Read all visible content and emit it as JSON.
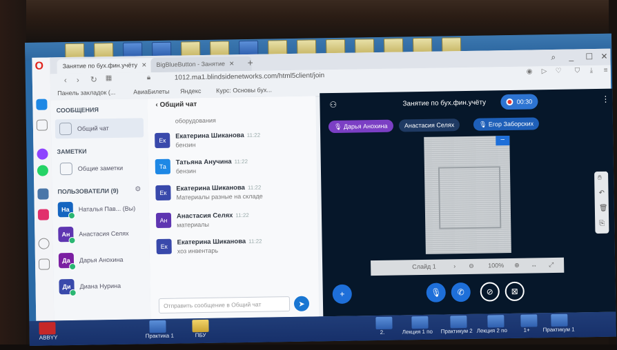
{
  "browser": {
    "tabs": [
      {
        "label": "Занятие по бух.фин.учёту"
      },
      {
        "label": "BigBlueButton - Занятие"
      }
    ],
    "url": "1012.ma1.blindsidenetworks.com/html5client/join",
    "bookmarks": [
      {
        "label": "Панель закладок (..."
      },
      {
        "label": "AвиаБилеты"
      },
      {
        "label": "Яндекс"
      },
      {
        "label": "Курс: Основы бух..."
      }
    ]
  },
  "sidebar": {
    "messages_header": "СООБЩЕНИЯ",
    "public_chat": "Общий чат",
    "notes_header": "ЗАМЕТКИ",
    "shared_notes": "Общие заметки",
    "users_header": "ПОЛЬЗОВАТЕЛИ (9)",
    "users": [
      {
        "initials": "На",
        "name": "Наталья Пав... (Вы)",
        "color": "#1565c0"
      },
      {
        "initials": "Ан",
        "name": "Анастасия Селях",
        "color": "#5e35b1"
      },
      {
        "initials": "Да",
        "name": "Дарья Анохина",
        "color": "#7b1fa2"
      },
      {
        "initials": "Ди",
        "name": "Диана Нурина",
        "color": "#3949ab"
      }
    ]
  },
  "chat": {
    "title": "Общий чат",
    "input_placeholder": "Отправить сообщение в Общий чат",
    "truncated_text": "оборудования",
    "messages": [
      {
        "initials": "Ек",
        "name": "Екатерина Шиканова",
        "time": "11:22",
        "text": "бензин",
        "color": "#3949ab"
      },
      {
        "initials": "Та",
        "name": "Татьяна Анучина",
        "time": "11:22",
        "text": "бензин",
        "color": "#1e88e5"
      },
      {
        "initials": "Ек",
        "name": "Екатерина Шиканова",
        "time": "11:22",
        "text": "Материалы разные на складе",
        "color": "#3949ab"
      },
      {
        "initials": "Ан",
        "name": "Анастасия Селях",
        "time": "11:22",
        "text": "материалы",
        "color": "#5e35b1"
      },
      {
        "initials": "Ек",
        "name": "Екатерина Шиканова",
        "time": "11:22",
        "text": "хоз инвентарь",
        "color": "#3949ab"
      }
    ]
  },
  "presentation": {
    "title": "Занятие по бух.фин.учёту",
    "recording_time": "00:30",
    "talkers": [
      {
        "name": "Дарья Анохина",
        "color": "#7b3fc4"
      },
      {
        "name": "Анастасия Селях",
        "color": "#1f3a63"
      },
      {
        "name": "Егор Заборских",
        "color": "#1e5fb8"
      }
    ],
    "slide_label": "Слайд 1",
    "zoom": "100%"
  },
  "taskbar": {
    "items": [
      {
        "label": "ABBYY"
      },
      {
        "label": "Практика 1"
      },
      {
        "label": "ПБУ"
      },
      {
        "label": "2."
      },
      {
        "label": "Лекция 1 по"
      },
      {
        "label": "Практикум 2"
      },
      {
        "label": "Лекция 2 по"
      },
      {
        "label": "1+"
      },
      {
        "label": "Практикум 1"
      }
    ]
  }
}
